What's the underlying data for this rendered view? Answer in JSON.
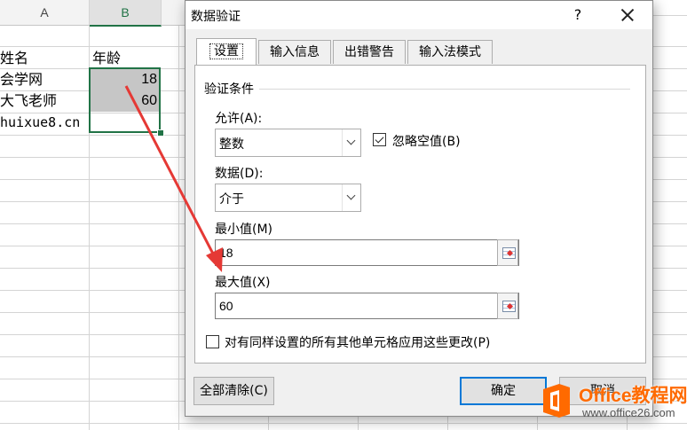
{
  "sheet": {
    "col_a": "A",
    "col_b": "B",
    "rows": [
      {
        "a": "",
        "b": ""
      },
      {
        "a": "姓名",
        "b": "年龄"
      },
      {
        "a": "会学网",
        "b": "18"
      },
      {
        "a": "大飞老师",
        "b": "60"
      },
      {
        "a": "huixue8.cn",
        "b": ""
      }
    ]
  },
  "dialog": {
    "title": "数据验证",
    "help": "?",
    "tabs": [
      "设置",
      "输入信息",
      "出错警告",
      "输入法模式"
    ],
    "group_label": "验证条件",
    "allow_label": "允许(A):",
    "allow_value": "整数",
    "ignore_blank_label": "忽略空值(B)",
    "ignore_blank_checked": true,
    "data_label": "数据(D):",
    "data_value": "介于",
    "min_label": "最小值(M)",
    "min_value": "18",
    "max_label": "最大值(X)",
    "max_value": "60",
    "apply_all_label": "对有同样设置的所有其他单元格应用这些更改(P)",
    "apply_all_checked": false,
    "clear_all_button": "全部清除(C)",
    "ok_button": "确定",
    "cancel_button": "取消"
  },
  "watermark": {
    "brand": "Office教程网",
    "url": "www.office26.com",
    "color": "#ff6a00"
  },
  "colors": {
    "accent": "#217346",
    "focus": "#0078d7",
    "arrow": "#e53935"
  }
}
